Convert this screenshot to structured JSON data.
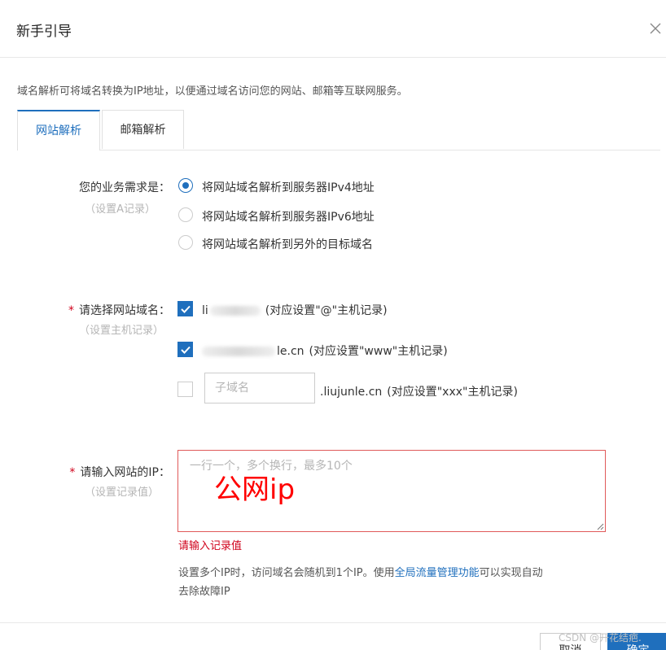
{
  "dialog": {
    "title": "新手引导",
    "close_icon": "close-icon"
  },
  "description": "域名解析可将域名转换为IP地址，以便通过域名访问您的网站、邮箱等互联网服务。",
  "tabs": [
    {
      "label": "网站解析",
      "active": true
    },
    {
      "label": "邮箱解析",
      "active": false
    }
  ],
  "business_need": {
    "label": "您的业务需求是：",
    "sub_label": "（设置A记录）",
    "options": [
      {
        "label": "将网站域名解析到服务器IPv4地址",
        "checked": true
      },
      {
        "label": "将网站域名解析到服务器IPv6地址",
        "checked": false
      },
      {
        "label": "将网站域名解析到另外的目标域名",
        "checked": false
      }
    ]
  },
  "domain_select": {
    "required_mark": "*",
    "label": "请选择网站域名：",
    "sub_label": "（设置主机记录）",
    "options": [
      {
        "prefix": "li",
        "suffix": "",
        "note": "(对应设置\"@\"主机记录)",
        "checked": true
      },
      {
        "prefix": "",
        "suffix": "le.cn",
        "note": "(对应设置\"www\"主机记录)",
        "checked": true
      },
      {
        "input_placeholder": "子域名",
        "suffix": ".liujunle.cn",
        "note": "(对应设置\"xxx\"主机记录)",
        "checked": false
      }
    ]
  },
  "ip_input": {
    "required_mark": "*",
    "label": "请输入网站的IP：",
    "sub_label": "（设置记录值）",
    "placeholder": "一行一个，多个换行，最多10个",
    "overlay_text": "公网ip",
    "error": "请输入记录值",
    "help_prefix": "设置多个IP时，访问域名会随机到1个IP。使用",
    "help_link": "全局流量管理功能",
    "help_suffix": "可以实现自动",
    "help_line2": "去除故障IP"
  },
  "footer": {
    "cancel_label": "取消",
    "ok_label": "确定",
    "watermark": "CSDN @开花结疤."
  },
  "colors": {
    "accent": "#1f6fbd",
    "error": "#d0021b",
    "overlay": "#ff0000"
  }
}
